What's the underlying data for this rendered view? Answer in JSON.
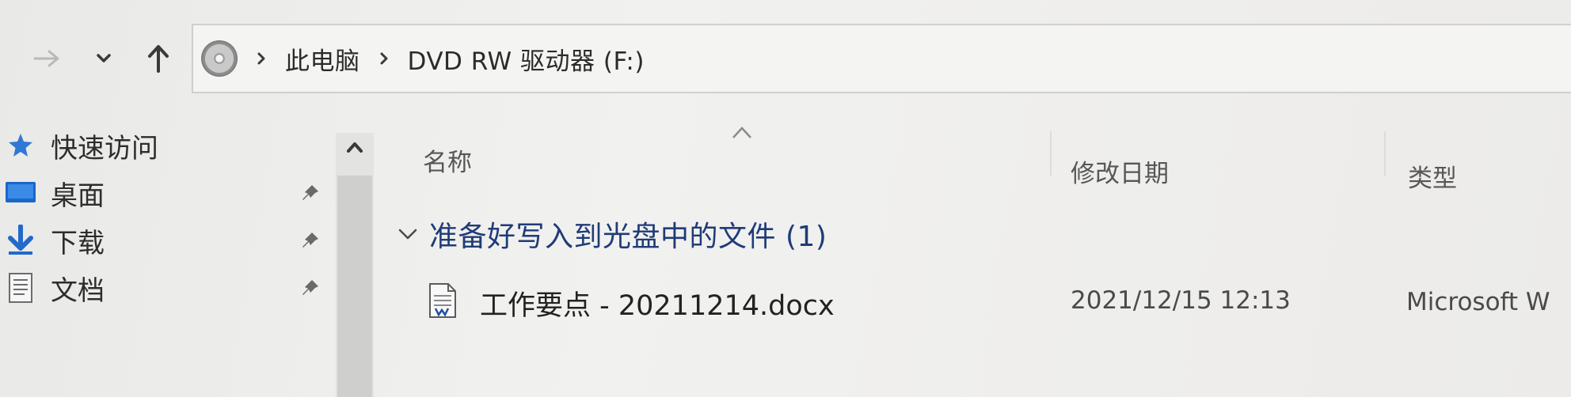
{
  "breadcrumb": {
    "items": [
      "此电脑",
      "DVD RW 驱动器 (F:)"
    ]
  },
  "sidebar": {
    "items": [
      {
        "label": "快速访问",
        "icon": "star-icon",
        "pinned": false
      },
      {
        "label": "桌面",
        "icon": "desktop-icon",
        "pinned": true
      },
      {
        "label": "下载",
        "icon": "download-icon",
        "pinned": true
      },
      {
        "label": "文档",
        "icon": "document-icon",
        "pinned": true
      }
    ]
  },
  "columns": {
    "name": "名称",
    "modified": "修改日期",
    "type": "类型"
  },
  "group": {
    "title": "准备好写入到光盘中的文件 (1)"
  },
  "files": [
    {
      "name": "工作要点 - 20211214.docx",
      "modified": "2021/12/15 12:13",
      "type": "Microsoft W"
    }
  ],
  "colors": {
    "accent": "#1f6fd1",
    "group_title": "#1f3b78"
  }
}
